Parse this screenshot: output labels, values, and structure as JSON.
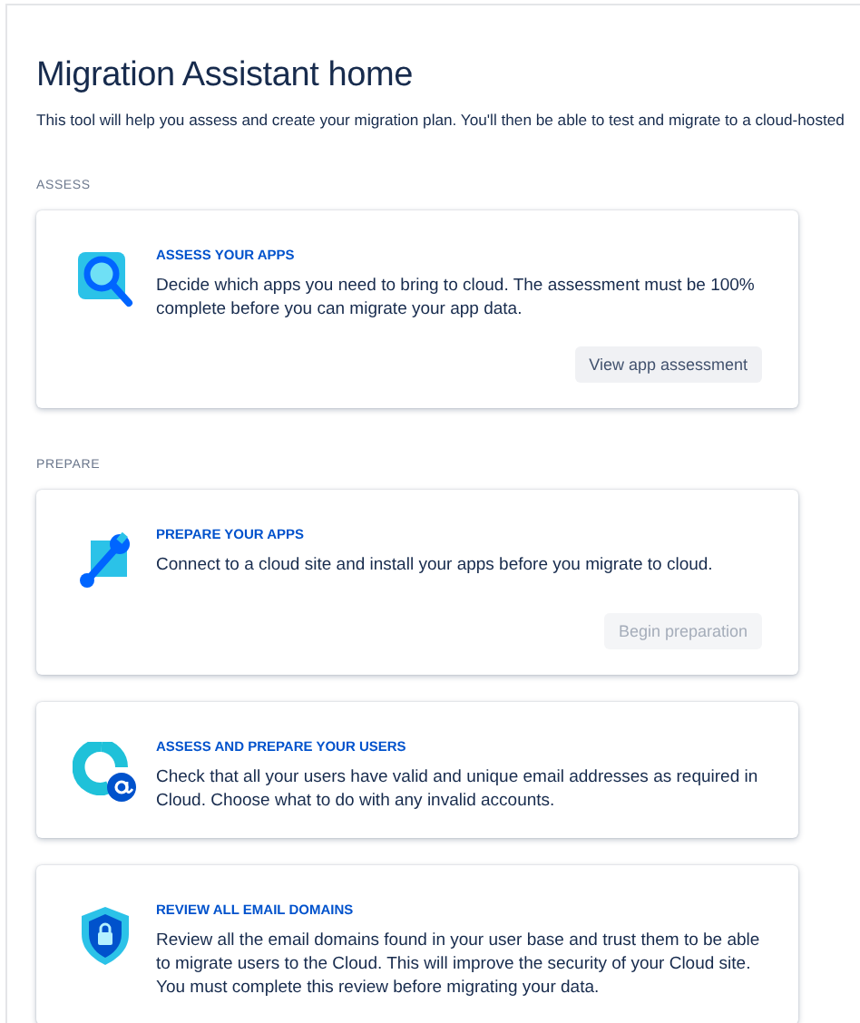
{
  "page": {
    "title": "Migration Assistant home",
    "intro": "This tool will help you assess and create your migration plan. You'll then be able to test and migrate to a cloud-hosted"
  },
  "sections": [
    {
      "label": "ASSESS",
      "cards": [
        {
          "kind": "magnifier",
          "title": "ASSESS YOUR APPS",
          "description": "Decide which apps you need to bring to cloud. The assessment must be 100% complete before you can migrate your app data.",
          "button": {
            "label": "View app assessment",
            "disabled": false
          }
        }
      ]
    },
    {
      "label": "PREPARE",
      "cards": [
        {
          "kind": "wrench",
          "title": "PREPARE YOUR APPS",
          "description": "Connect to a cloud site and install your apps before you migrate to cloud.",
          "button": {
            "label": "Begin preparation",
            "disabled": true
          }
        },
        {
          "kind": "user-email",
          "title": "ASSESS AND PREPARE YOUR USERS",
          "description": "Check that all your users have valid and unique email addresses as required in Cloud. Choose what to do with any invalid accounts."
        },
        {
          "kind": "shield",
          "title": "REVIEW ALL EMAIL DOMAINS",
          "description": "Review all the email domains found in your user base and trust them to be able to migrate users to the Cloud. This will improve the security of your Cloud site. You must complete this review before migrating your data."
        }
      ]
    }
  ]
}
